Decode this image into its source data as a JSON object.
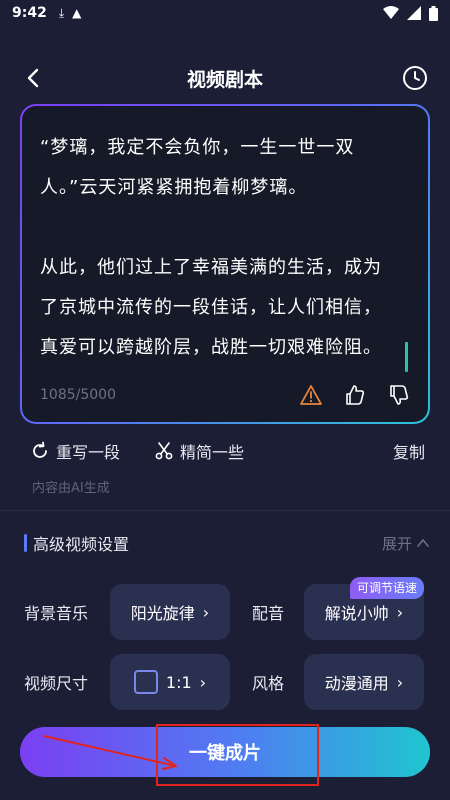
{
  "status_bar": {
    "time": "9:42"
  },
  "header": {
    "title": "视频剧本"
  },
  "script": {
    "lines": [
      "“梦璃，我定不会负你，一生一世一双",
      "人。”云天河紧紧拥抱着柳梦璃。",
      "",
      "从此，他们过上了幸福美满的生活，成为",
      "了京城中流传的一段佳话，让人们相信，",
      "真爱可以跨越阶层，战胜一切艰难险阻。"
    ],
    "counter": "1085/5000"
  },
  "actions": {
    "rewrite_label": "重写一段",
    "simplify_label": "精简一些",
    "copy_label": "复制",
    "ai_note": "内容由AI生成"
  },
  "advanced": {
    "title": "高级视频设置",
    "expand_label": "展开"
  },
  "settings": {
    "music_label": "背景音乐",
    "music_value": "阳光旋律",
    "voice_label": "配音",
    "voice_value": "解说小帅",
    "voice_badge": "可调节语速",
    "size_label": "视频尺寸",
    "size_value": "1:1",
    "style_label": "风格",
    "style_value": "动漫通用"
  },
  "generate": {
    "label": "一键成片"
  },
  "colors": {
    "background": "#1c1e36",
    "accent_purple": "#7b3ff2",
    "accent_cyan": "#1fc6cf",
    "annotation_red": "#e1241d"
  }
}
